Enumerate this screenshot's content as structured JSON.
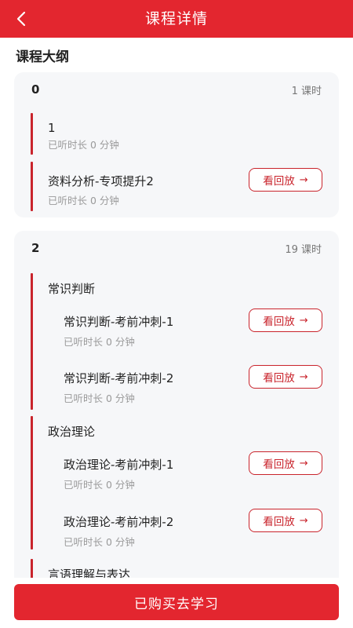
{
  "header": {
    "title": "课程详情",
    "back_icon": "chevron-left-icon",
    "color": "#e3262f"
  },
  "section_title": "课程大纲",
  "chapters": [
    {
      "number": "0",
      "lesson_count": "1 课时",
      "items": [
        {
          "title": "1",
          "listened": "已听时长 0 分钟"
        },
        {
          "title": "资料分析-专项提升2",
          "listened": "已听时长 0 分钟",
          "button": "看回放"
        }
      ]
    },
    {
      "number": "2",
      "lesson_count": "19 课时",
      "groups": [
        {
          "title": "常识判断",
          "items": [
            {
              "title": "常识判断-考前冲刺-1",
              "listened": "已听时长 0 分钟",
              "button": "看回放"
            },
            {
              "title": "常识判断-考前冲刺-2",
              "listened": "已听时长 0 分钟",
              "button": "看回放"
            }
          ]
        },
        {
          "title": "政治理论",
          "items": [
            {
              "title": "政治理论-考前冲刺-1",
              "listened": "已听时长 0 分钟",
              "button": "看回放"
            },
            {
              "title": "政治理论-考前冲刺-2",
              "listened": "已听时长 0 分钟",
              "button": "看回放"
            }
          ]
        },
        {
          "title": "言语理解与表达",
          "items": []
        }
      ]
    }
  ],
  "bottom_button": "已购买去学习",
  "arrow_glyph": "→",
  "accent_color": "#c9242c"
}
